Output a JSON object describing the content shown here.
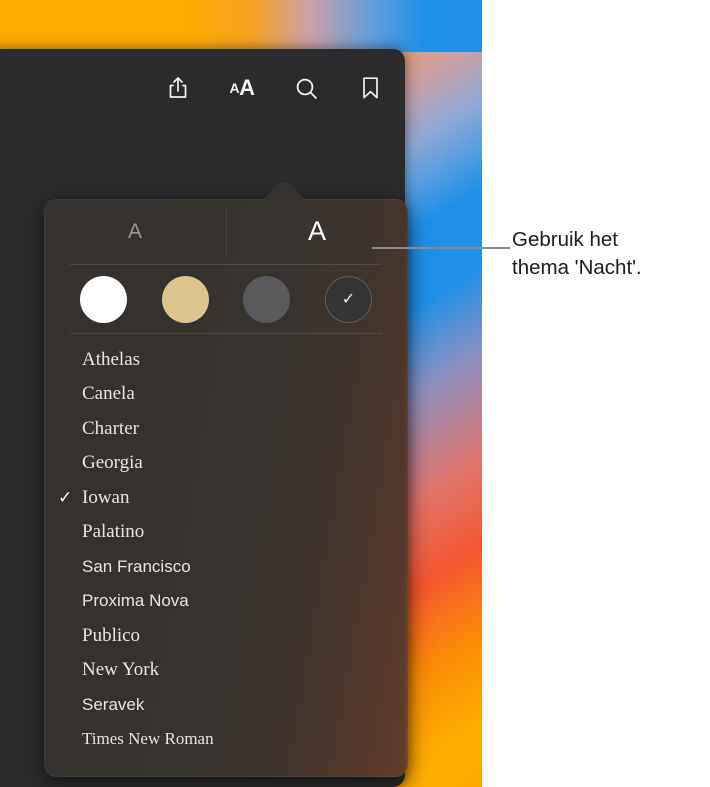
{
  "wallpaper": {
    "name": "macos-big-sur-gradient",
    "colors": [
      "#ffab00",
      "#1e90e8",
      "#f4562f",
      "#ffa800"
    ]
  },
  "reader_window": {
    "toolbar": {
      "icons": [
        {
          "name": "share-icon",
          "label": "Deel"
        },
        {
          "name": "text-size-icon",
          "label": "aA",
          "small_a": "A",
          "large_a": "A"
        },
        {
          "name": "search-icon",
          "label": "Zoek"
        },
        {
          "name": "bookmark-icon",
          "label": "Bladwijzer"
        }
      ]
    }
  },
  "font_popover": {
    "size_controls": {
      "decrease_label": "A",
      "increase_label": "A"
    },
    "themes": [
      {
        "name": "white",
        "label": "Wit",
        "color": "#ffffff",
        "selected": false,
        "check": ""
      },
      {
        "name": "sepia",
        "label": "Sepia",
        "color": "#dcc48f",
        "selected": false,
        "check": ""
      },
      {
        "name": "gray",
        "label": "Grijs",
        "color": "#5a5a5c",
        "selected": false,
        "check": ""
      },
      {
        "name": "night",
        "label": "Nacht",
        "color": "#343434",
        "selected": true,
        "check": "✓"
      }
    ],
    "fonts": [
      {
        "label": "Athelas",
        "check": "",
        "style": "serif"
      },
      {
        "label": "Canela",
        "check": "",
        "style": "serif"
      },
      {
        "label": "Charter",
        "check": "",
        "style": "serif"
      },
      {
        "label": "Georgia",
        "check": "",
        "style": "serif"
      },
      {
        "label": "Iowan",
        "check": "✓",
        "style": "serif"
      },
      {
        "label": "Palatino",
        "check": "",
        "style": "serif"
      },
      {
        "label": "San Francisco",
        "check": "",
        "style": "sans"
      },
      {
        "label": "Proxima Nova",
        "check": "",
        "style": "sans"
      },
      {
        "label": "Publico",
        "check": "",
        "style": "serif"
      },
      {
        "label": "New York",
        "check": "",
        "style": "serif"
      },
      {
        "label": "Seravek",
        "check": "",
        "style": "sans"
      },
      {
        "label": "Times New Roman",
        "check": "",
        "style": "tnr"
      }
    ]
  },
  "callout": {
    "line1": "Gebruik het",
    "line2": "thema 'Nacht'.",
    "line_color": "#8a8a8a"
  }
}
